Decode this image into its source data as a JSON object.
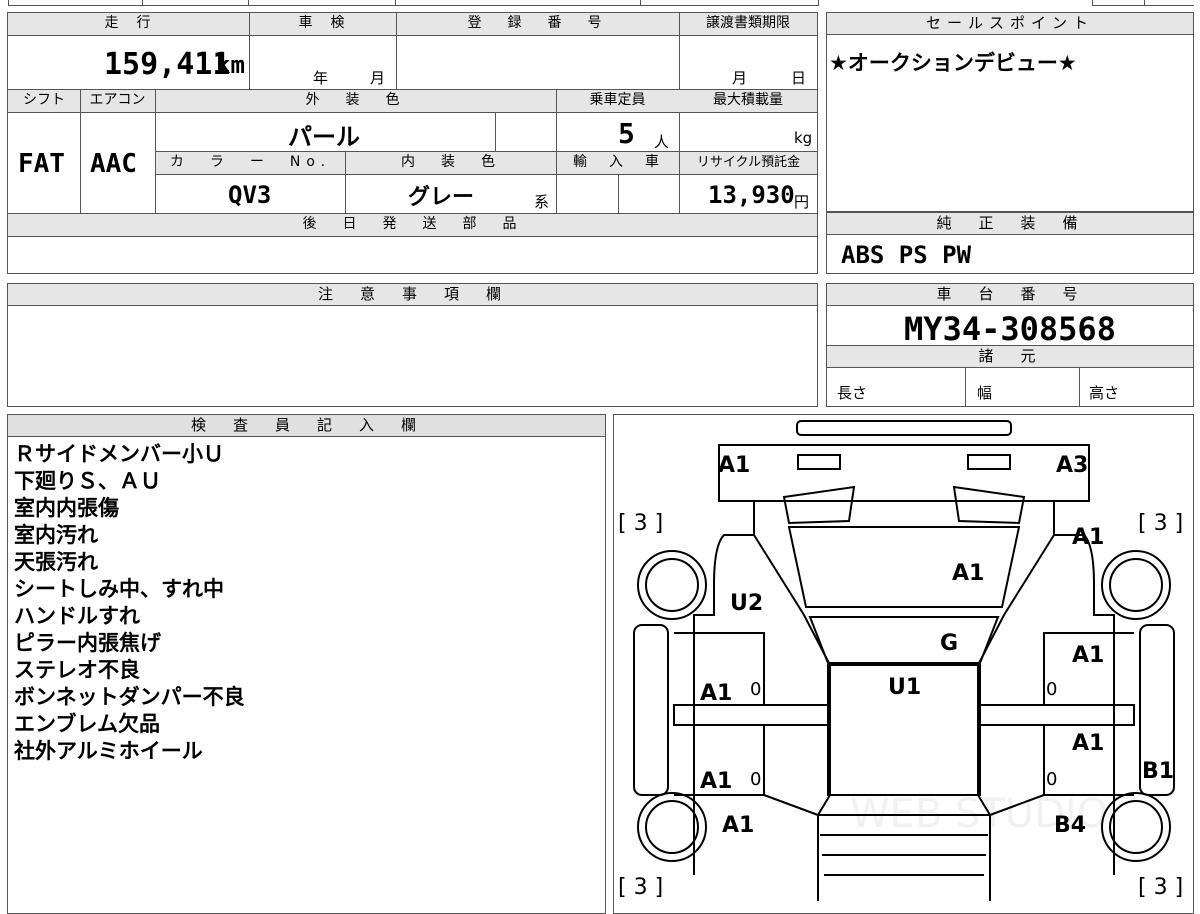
{
  "main_table": {
    "headers": {
      "mileage": "走　行",
      "shaken": "車　検",
      "registration": "登　録　番　号",
      "transfer_deadline": "譲渡書類期限",
      "shift": "シフト",
      "aircon": "エアコン",
      "exterior_color": "外　装　色",
      "capacity": "乗車定員",
      "max_load": "最大積載量",
      "color_no": "カ　ラ　ー　No.",
      "interior_color": "内　装　色",
      "import": "輸　入　車",
      "recycle_fee": "リサイクル預託金",
      "later_parts": "後　日　発　送　部　品"
    },
    "mileage_value": "159,411",
    "mileage_unit": "km",
    "shaken_year": "年",
    "shaken_month": "月",
    "transfer_month": "月",
    "transfer_day": "日",
    "shift_value": "FAT",
    "aircon_value": "AAC",
    "exterior_color_value": "パール",
    "capacity_value": "5",
    "capacity_unit": "人",
    "max_load_unit": "kg",
    "color_no_value": "QV3",
    "interior_color_value": "グレー",
    "interior_suffix": "系",
    "recycle_value": "13,930",
    "recycle_unit": "円"
  },
  "sales_point": {
    "header": "セールスポイント",
    "text": "★オークションデビュー★"
  },
  "genuine_equipment": {
    "header": "純　正　装　備",
    "text": "ABS PS PW"
  },
  "notes": {
    "header": "注　意　事　項　欄"
  },
  "chassis": {
    "header": "車　台　番　号",
    "value": "MY34-308568"
  },
  "specs": {
    "header": "諸　元",
    "length": "長さ",
    "width": "幅",
    "height": "高さ"
  },
  "inspector": {
    "header": "検　査　員　記　入　欄",
    "lines": [
      "Ｒサイドメンバー小Ｕ",
      "下廻りＳ、ＡＵ",
      "室内内張傷",
      "室内汚れ",
      "天張汚れ",
      "シートしみ中、すれ中",
      "ハンドルすれ",
      "ピラー内張焦げ",
      "ステレオ不良",
      "ボンネットダンパー不良",
      "エンブレム欠品",
      "社外アルミホイール"
    ]
  },
  "diagram": {
    "tire_front_left": "[ 3 ]",
    "tire_front_right": "[ 3 ]",
    "tire_rear_left": "[ 3 ]",
    "tire_rear_right": "[ 3 ]",
    "marks": {
      "front_bumper_left": "A1",
      "front_bumper_right": "A3",
      "right_front_fender": "A1",
      "hood": "A1",
      "left_front_fender": "U2",
      "windshield": "G",
      "roof": "U1",
      "right_front_door": "A1",
      "left_front_door": "A1",
      "right_rear_door": "A1",
      "left_rear_door": "A1",
      "right_rocker": "B1",
      "left_rear_fender": "A1",
      "right_rear_fender": "B4",
      "zero_1": "0",
      "zero_2": "0",
      "zero_3": "0",
      "zero_4": "0"
    },
    "watermark": "WEB STUDIO"
  }
}
